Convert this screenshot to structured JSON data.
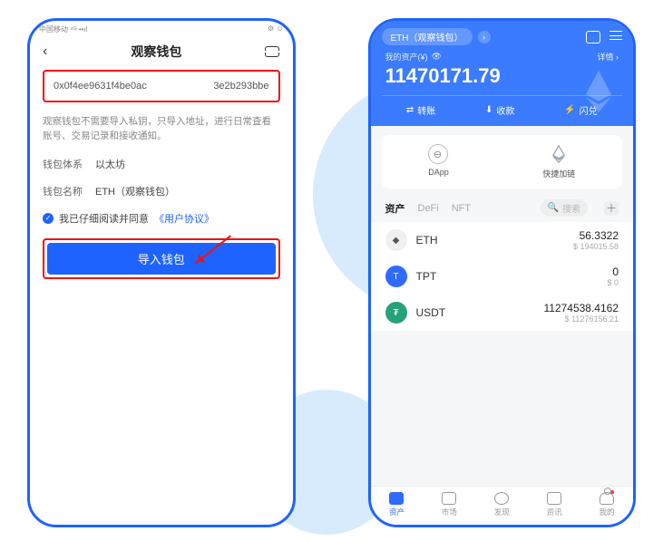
{
  "left": {
    "status_left": "中国移动 ⁴ᴳ ••ıl",
    "status_right": "⚙ ☺",
    "title": "观察钱包",
    "addr_left": "0x0f4ee9631f4be0ac",
    "addr_right": "3e2b293bbe",
    "desc": "观察钱包不需要导入私钥，只导入地址，进行日常查看账号、交易记录和接收通知。",
    "sys_label": "钱包体系",
    "sys_value": "以太坊",
    "name_label": "钱包名称",
    "name_value": "ETH（观察钱包）",
    "agree_prefix": "我已仔细阅读并同意",
    "agree_link": "《用户协议》",
    "import_btn": "导入钱包"
  },
  "right": {
    "chip": "ETH（观察钱包）",
    "bal_label": "我的资产(¥)",
    "bal_detail": "详情 ›",
    "balance": "11470171.79",
    "act_transfer": "转账",
    "act_receive": "收款",
    "act_swap": "闪兑",
    "icon_dapp": "DApp",
    "icon_chain": "快捷加链",
    "tabs": {
      "t1": "资产",
      "t2": "DeFi",
      "t3": "NFT"
    },
    "search_ph": "搜索",
    "assets": [
      {
        "sym": "ETH",
        "amt": "56.3322",
        "fiat": "$ 194015.58"
      },
      {
        "sym": "TPT",
        "amt": "0",
        "fiat": "$ 0"
      },
      {
        "sym": "USDT",
        "amt": "11274538.4162",
        "fiat": "$ 11276156.21"
      }
    ],
    "nav": {
      "n1": "资产",
      "n2": "市场",
      "n3": "发现",
      "n4": "资讯",
      "n5": "我的"
    }
  }
}
